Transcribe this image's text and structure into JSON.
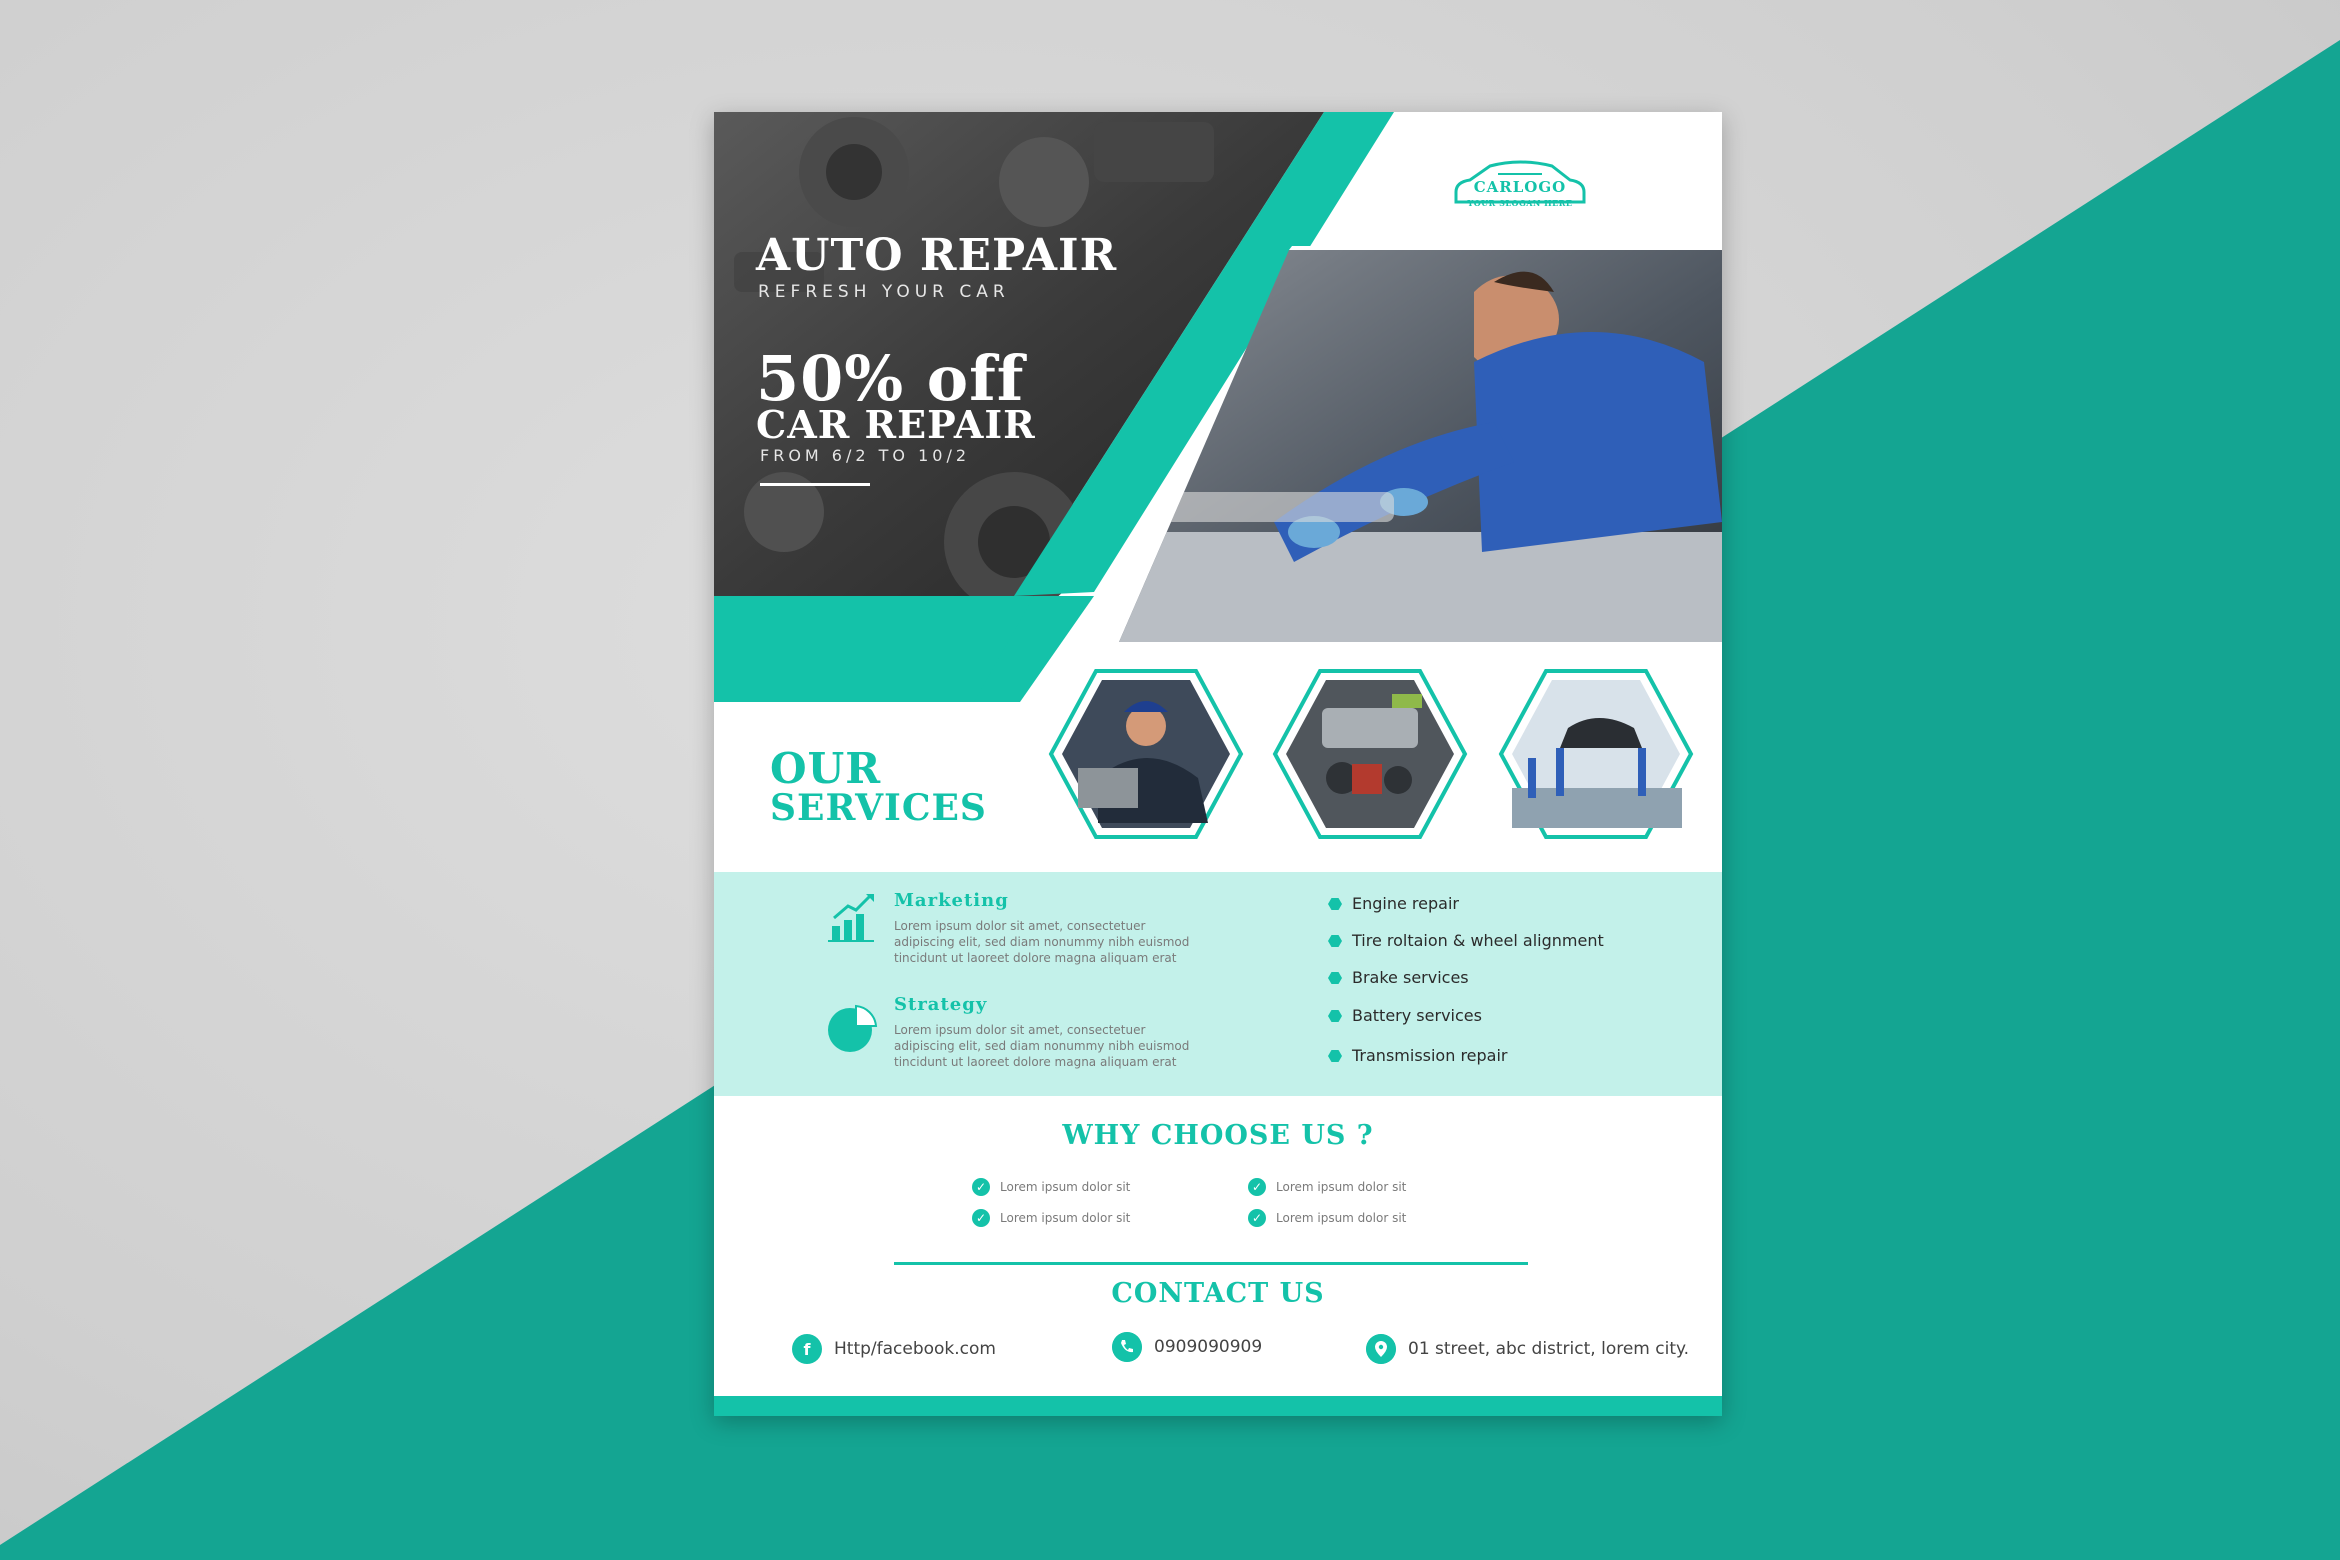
{
  "colors": {
    "brand": "#14c2a9",
    "band": "#c3f1ea",
    "dark": "#2a2a2a"
  },
  "hero": {
    "title": "AUTO REPAIR",
    "subtitle": "REFRESH YOUR CAR",
    "promo_big": "50% off",
    "promo_mid": "CAR REPAIR",
    "promo_dates": "FROM 6/2 TO 10/2"
  },
  "logo": {
    "name": "CARLOGO",
    "slogan": "YOUR SLOGAN HERE",
    "icon": "car-outline-icon"
  },
  "services": {
    "title_line1": "OUR",
    "title_line2": "SERVICES",
    "features": [
      {
        "title": "Marketing",
        "icon": "growth-chart-icon",
        "text": "Lorem ipsum dolor sit amet, consectetuer adipiscing elit, sed diam nonummy nibh euismod tincidunt ut laoreet dolore magna aliquam erat"
      },
      {
        "title": "Strategy",
        "icon": "pie-chart-icon",
        "text": "Lorem ipsum dolor sit amet, consectetuer adipiscing elit, sed diam nonummy nibh euismod tincidunt ut laoreet dolore magna aliquam erat"
      }
    ],
    "list": [
      "Engine repair",
      "Tire roltaion & wheel alignment",
      "Brake services",
      "Battery services",
      "Transmission repair"
    ]
  },
  "why": {
    "title": "WHY CHOOSE US ?",
    "items": [
      "Lorem ipsum dolor sit",
      "Lorem ipsum dolor sit",
      "Lorem ipsum dolor sit",
      "Lorem ipsum dolor sit"
    ]
  },
  "contact": {
    "title": "CONTACT US",
    "facebook": "Http/facebook.com",
    "phone": "0909090909",
    "address": "01 street, abc district, lorem city.",
    "icons": [
      "facebook-icon",
      "phone-icon",
      "location-pin-icon"
    ]
  }
}
